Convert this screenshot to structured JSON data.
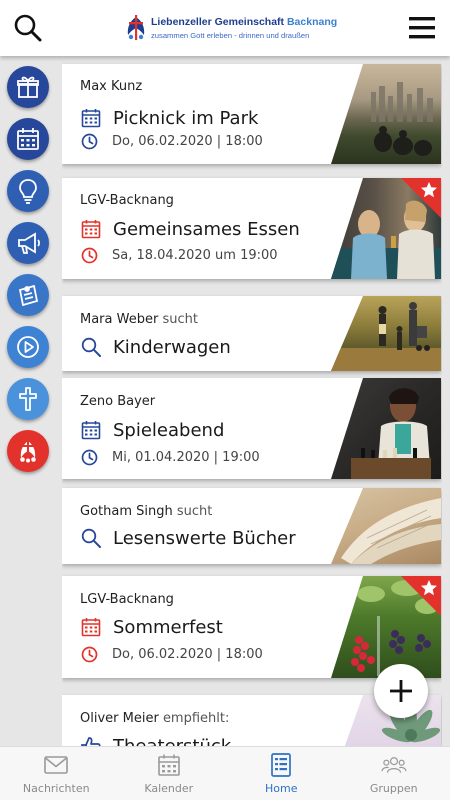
{
  "header": {
    "logo_title_main": "Liebenzeller Gemeinschaft",
    "logo_title_accent": "Backnang",
    "logo_subtitle": "zusammen Gott erleben - drinnen und draußen",
    "search_icon": "search-icon",
    "menu_icon": "hamburger-menu-icon"
  },
  "rail": [
    {
      "icon": "gift-icon",
      "color": "#27489a"
    },
    {
      "icon": "calendar-icon",
      "color": "#27489a"
    },
    {
      "icon": "lightbulb-icon",
      "color": "#2e5fb3"
    },
    {
      "icon": "megaphone-icon",
      "color": "#2e5fb3"
    },
    {
      "icon": "pin-note-icon",
      "color": "#3a76c8"
    },
    {
      "icon": "play-icon",
      "color": "#3d82d3"
    },
    {
      "icon": "cross-icon",
      "color": "#4a92dc"
    },
    {
      "icon": "community-logo-icon",
      "color": "#e3322b"
    }
  ],
  "cards": [
    {
      "author": "Max Kunz",
      "author_suffix": "",
      "type": "event",
      "title": "Picknick im Park",
      "date": "Do, 06.02.2020 | 18:00",
      "highlighted": false,
      "accent": "#27489a"
    },
    {
      "author": "LGV-Backnang",
      "author_suffix": "",
      "type": "event",
      "title": "Gemeinsames Essen",
      "date": "Sa, 18.04.2020 um 19:00",
      "highlighted": true,
      "accent": "#e3322b"
    },
    {
      "author": "Mara Weber",
      "author_suffix": "sucht",
      "type": "search",
      "title": "Kinderwagen",
      "date": "",
      "highlighted": false,
      "accent": "#27489a"
    },
    {
      "author": "Zeno Bayer",
      "author_suffix": "",
      "type": "event",
      "title": "Spieleabend",
      "date": "Mi, 01.04.2020 | 19:00",
      "highlighted": false,
      "accent": "#27489a"
    },
    {
      "author": "Gotham Singh",
      "author_suffix": "sucht",
      "type": "search",
      "title": "Lesenswerte Bücher",
      "date": "",
      "highlighted": false,
      "accent": "#27489a"
    },
    {
      "author": "LGV-Backnang",
      "author_suffix": "",
      "type": "event",
      "title": "Sommerfest",
      "date": "Do, 06.02.2020 | 18:00",
      "highlighted": true,
      "accent": "#e3322b"
    },
    {
      "author": "Oliver Meier",
      "author_suffix": "empfiehlt:",
      "type": "recommend",
      "title": "Theaterstück",
      "date": "",
      "highlighted": false,
      "accent": "#27489a"
    }
  ],
  "fab": {
    "icon": "plus-icon"
  },
  "nav": [
    {
      "label": "Nachrichten",
      "icon": "mail-icon",
      "active": false
    },
    {
      "label": "Kalender",
      "icon": "calendar-icon",
      "active": false
    },
    {
      "label": "Home",
      "icon": "home-list-icon",
      "active": true
    },
    {
      "label": "Gruppen",
      "icon": "group-icon",
      "active": false
    }
  ]
}
